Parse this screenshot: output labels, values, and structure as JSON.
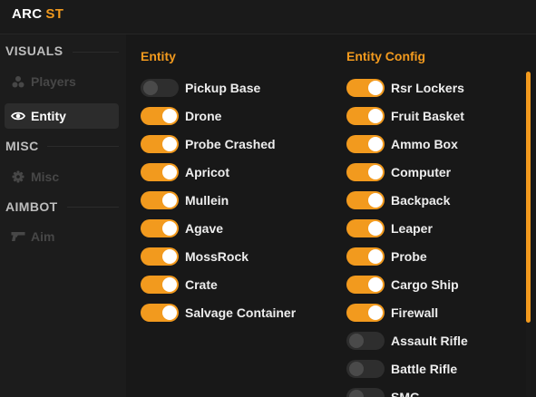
{
  "app": {
    "title_part1": "ARC",
    "title_part2": "ST"
  },
  "sidebar": {
    "sections": [
      {
        "header": "VISUALS",
        "items": [
          {
            "label": "Players",
            "icon": "players-icon",
            "active": false
          },
          {
            "label": "Entity",
            "icon": "eye-icon",
            "active": true
          }
        ]
      },
      {
        "header": "MISC",
        "items": [
          {
            "label": "Misc",
            "icon": "gear-icon",
            "active": false
          }
        ]
      },
      {
        "header": "AIMBOT",
        "items": [
          {
            "label": "Aim",
            "icon": "gun-icon",
            "active": false
          }
        ]
      }
    ]
  },
  "entity": {
    "title": "Entity",
    "toggles": [
      {
        "label": "Pickup Base",
        "on": false
      },
      {
        "label": "Drone",
        "on": true
      },
      {
        "label": "Probe Crashed",
        "on": true
      },
      {
        "label": "Apricot",
        "on": true
      },
      {
        "label": "Mullein",
        "on": true
      },
      {
        "label": "Agave",
        "on": true
      },
      {
        "label": "MossRock",
        "on": true
      },
      {
        "label": "Crate",
        "on": true
      },
      {
        "label": "Salvage Container",
        "on": true
      }
    ]
  },
  "entity_config": {
    "title": "Entity Config",
    "toggles": [
      {
        "label": "Rsr Lockers",
        "on": true
      },
      {
        "label": "Fruit Basket",
        "on": true
      },
      {
        "label": "Ammo Box",
        "on": true
      },
      {
        "label": "Computer",
        "on": true
      },
      {
        "label": "Backpack",
        "on": true
      },
      {
        "label": "Leaper",
        "on": true
      },
      {
        "label": "Probe",
        "on": true
      },
      {
        "label": "Cargo Ship",
        "on": true
      },
      {
        "label": "Firewall",
        "on": true
      },
      {
        "label": "Assault Rifle",
        "on": false
      },
      {
        "label": "Battle Rifle",
        "on": false
      },
      {
        "label": "SMG",
        "on": false
      }
    ]
  },
  "colors": {
    "accent": "#f29a1e",
    "background": "#181818",
    "sidebar": "#1c1c1c"
  },
  "scroll": {
    "position": 0
  }
}
